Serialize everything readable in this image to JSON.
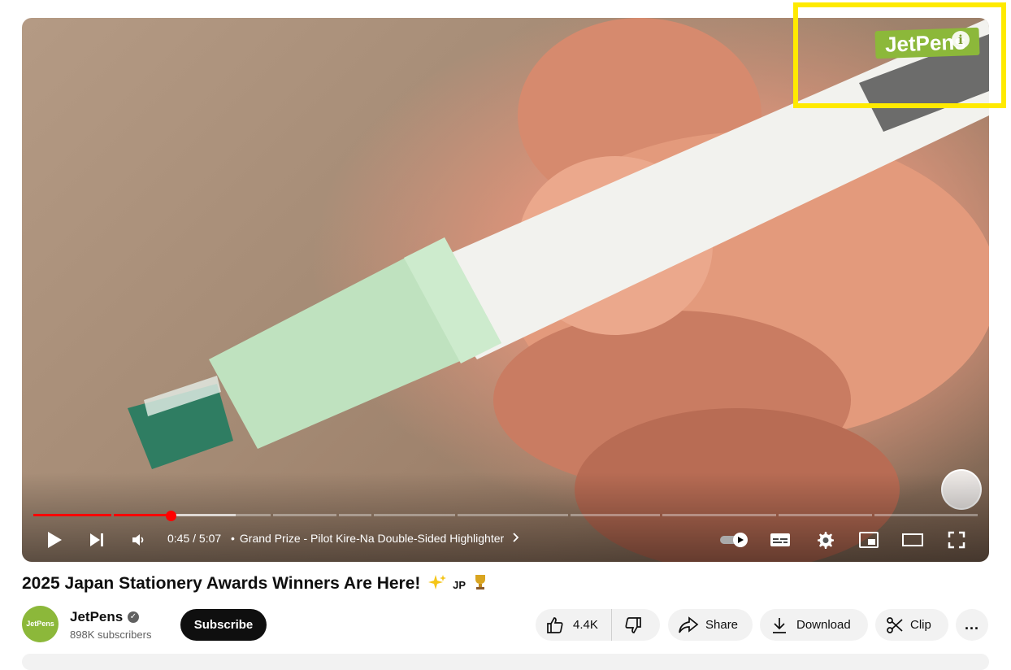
{
  "player": {
    "watermark": "JetPens",
    "info_glyph": "i",
    "time_display": "0:45 / 5:07",
    "chapter_title": "Grand Prize - Pilot Kire-Na Double-Sided Highlighter",
    "played_fraction": 0.146,
    "progress_color": "#ff0000"
  },
  "video": {
    "title": "2025 Japan Stationery Awards Winners Are Here!",
    "title_badge": "JP"
  },
  "channel": {
    "name": "JetPens",
    "avatar_text": "JetPens",
    "subscribers": "898K subscribers",
    "subscribe_label": "Subscribe"
  },
  "actions": {
    "like_count": "4.4K",
    "share_label": "Share",
    "download_label": "Download",
    "clip_label": "Clip",
    "more_label": "..."
  },
  "colors": {
    "brand_green": "#8cb83a",
    "highlight": "#ffea00"
  }
}
